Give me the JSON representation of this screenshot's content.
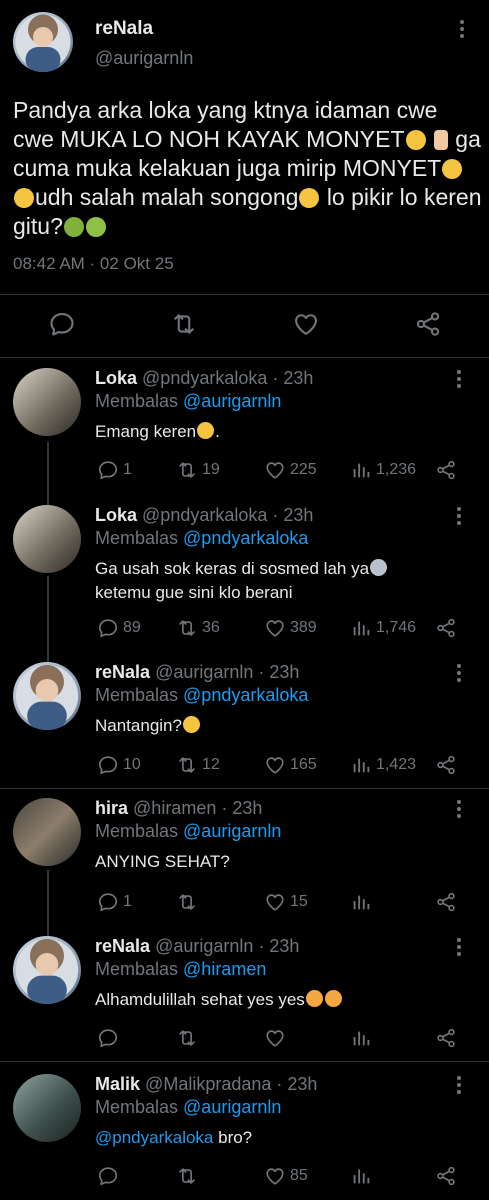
{
  "main_tweet": {
    "author": "reNala",
    "handle": "@aurigarnln",
    "text": "Pandya arka loka yang ktnya idaman cwe cwe MUKA LO NOH KAYAK MONYET",
    "text_2": "ga cuma muka kelakuan juga mirip MONYET",
    "text_3": "udh salah malah songong",
    "text_4": "lo pikir lo keren gitu?",
    "timestamp": "08:42 AM · 02 Okt 25"
  },
  "replies": [
    {
      "author": "Loka",
      "handle": "@pndyarkaloka · 23h",
      "replying_prefix": "Membalas ",
      "replying_to": "@aurigarnln",
      "text": "Emang keren",
      "text_after": ".",
      "replies": "1",
      "retweets": "19",
      "likes": "225",
      "views": "1,236"
    },
    {
      "author": "Loka",
      "handle": "@pndyarkaloka · 23h",
      "replying_prefix": "Membalas ",
      "replying_to": "@pndyarkaloka",
      "text": "Ga usah sok keras di sosmed lah ya",
      "text_line2": "ketemu gue sini klo berani",
      "replies": "89",
      "retweets": "36",
      "likes": "389",
      "views": "1,746"
    },
    {
      "author": "reNala",
      "handle": "@aurigarnln · 23h",
      "replying_prefix": "Membalas ",
      "replying_to": "@pndyarkaloka",
      "text": "Nantangin?",
      "replies": "10",
      "retweets": "12",
      "likes": "165",
      "views": "1,423"
    },
    {
      "author": "hira",
      "handle": "@hiramen · 23h",
      "replying_prefix": "Membalas ",
      "replying_to": "@aurigarnln",
      "text": "ANYING SEHAT?",
      "replies": "1",
      "retweets": "",
      "likes": "15",
      "views": ""
    },
    {
      "author": "reNala",
      "handle": "@aurigarnln · 23h",
      "replying_prefix": "Membalas ",
      "replying_to": "@hiramen",
      "text": "Alhamdulillah sehat yes yes",
      "replies": "",
      "retweets": "",
      "likes": "",
      "views": ""
    },
    {
      "author": "Malik",
      "handle": "@Malikpradana · 23h",
      "replying_prefix": "Membalas ",
      "replying_to": "@aurigarnln",
      "mention": "@pndyarkaloka",
      "text": " bro?",
      "replies": "",
      "retweets": "",
      "likes": "85",
      "views": ""
    }
  ],
  "colors": {
    "background": "#000000",
    "text": "#e7e9ea",
    "secondary": "#71767b",
    "accent": "#1d9bf0",
    "divider": "#2f3336"
  },
  "icons": [
    "reply-icon",
    "retweet-icon",
    "like-icon",
    "views-icon",
    "share-icon",
    "more-icon"
  ]
}
